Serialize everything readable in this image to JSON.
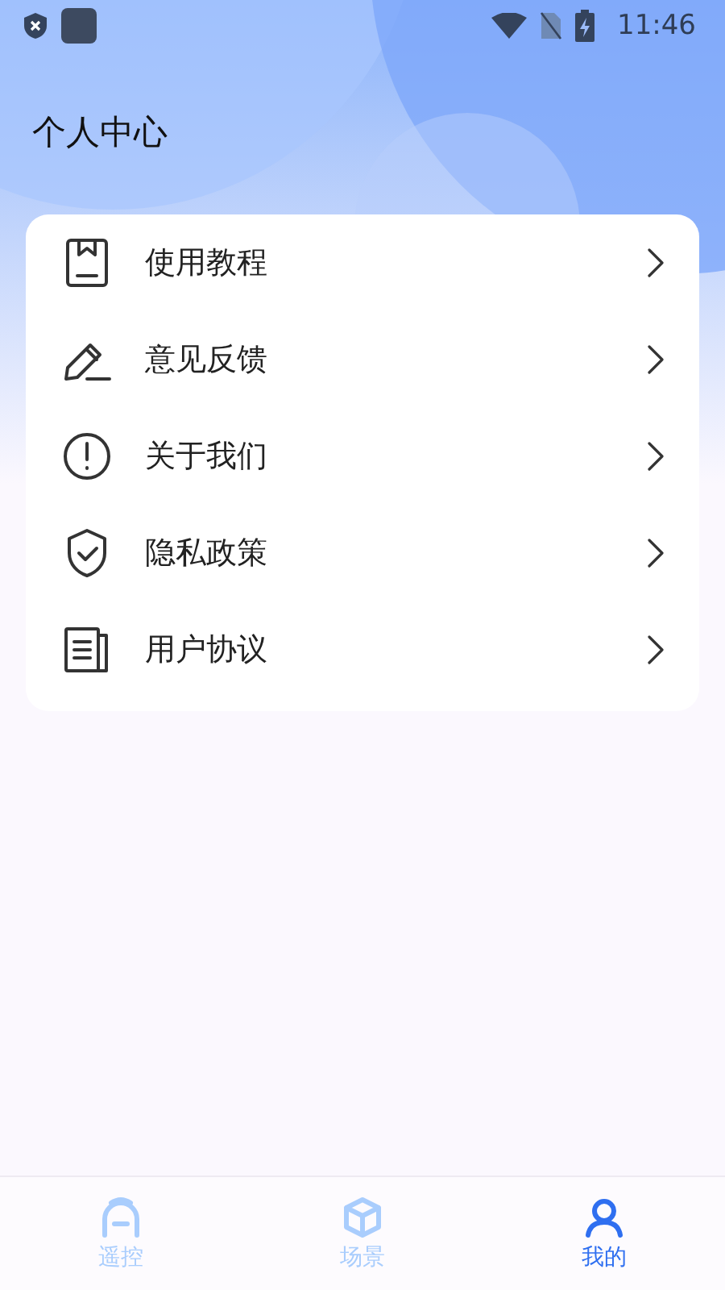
{
  "status_bar": {
    "time": "11:46"
  },
  "header": {
    "title": "个人中心"
  },
  "menu": [
    {
      "kind": "book",
      "label": "使用教程"
    },
    {
      "kind": "pencil",
      "label": "意见反馈"
    },
    {
      "kind": "info",
      "label": "关于我们"
    },
    {
      "kind": "shield",
      "label": "隐私政策"
    },
    {
      "kind": "document",
      "label": "用户协议"
    }
  ],
  "tab_bar": [
    {
      "kind": "remote",
      "label": "遥控",
      "selected": false
    },
    {
      "kind": "cube",
      "label": "场景",
      "selected": false
    },
    {
      "kind": "person",
      "label": "我的",
      "selected": true
    }
  ]
}
